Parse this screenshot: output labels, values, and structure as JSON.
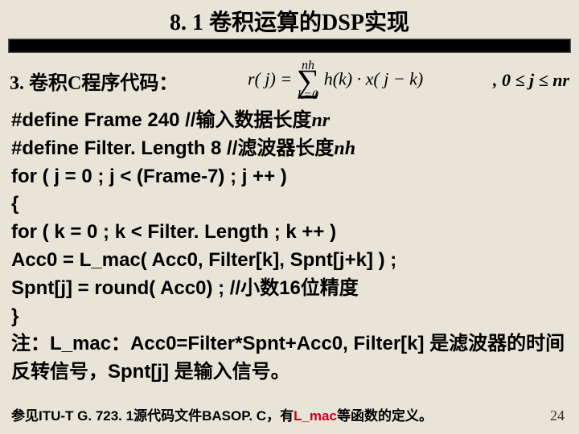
{
  "title": "8. 1 卷积运算的DSP实现",
  "section_title": "3. 卷积C程序代码：",
  "formula": {
    "lhs": "r( j) =",
    "sum_top": "nh",
    "sum_bottom": "k=0",
    "rhs": "h(k) · x( j − k)"
  },
  "range": ", 0 ≤ j ≤ nr",
  "code": {
    "l1a": "#define Frame  240   //输入数据长度",
    "l1b": "nr",
    "l2a": "#define  Filter. Length  8  //滤波器长度",
    "l2b": "nh",
    "l3": "for ( j = 0 ; j < (Frame-7) ; j ++ )",
    "l4": "{",
    "l5": "for ( k = 0 ; k <  Filter. Length ; k ++ )",
    "l6": "  Acc0 = L_mac( Acc0, Filter[k], Spnt[j+k] ) ;",
    "l7": "  Spnt[j] = round( Acc0) ; //小数16位精度",
    "l8": "}",
    "l9": "注：L_mac：Acc0=Filter*Spnt+Acc0,    Filter[k] 是滤波器的时间反转信号，Spnt[j] 是输入信号。"
  },
  "footnote": {
    "a": "参见ITU-T G. 723. 1源代码文件",
    "b": "BASOP. C",
    "c": "，有",
    "d": "L_mac",
    "e": "等函数的定义。"
  },
  "page": "24"
}
